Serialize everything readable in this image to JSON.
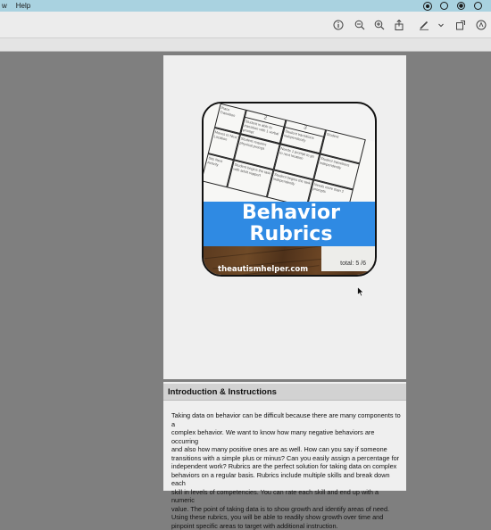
{
  "menubar": {
    "items": [
      "w",
      "Help"
    ],
    "tray_icons": [
      "record-icon",
      "chat-icon",
      "chrome-icon",
      "options-icon"
    ]
  },
  "toolbar": {
    "buttons": [
      "info-icon",
      "zoom-out-icon",
      "zoom-in-icon",
      "share-icon",
      "markup-pen-icon",
      "chevron-down-icon",
      "rotate-icon",
      "markup-circle-icon"
    ]
  },
  "document": {
    "cover": {
      "title_line1": "Behavior",
      "title_line2": "Rubrics",
      "website": "theautismhelper.com",
      "total_label": "total:",
      "total_value": "5 /6",
      "sheet_cells": [
        "Place Transition",
        "2",
        "Student is able to transition with 1 verbal prompt",
        "3",
        "Student transitions independently",
        "Moves to Next Location",
        "Student requires physical prompt",
        "Needs 1 prompt to go to next location",
        "Student transitions independently",
        "Sits Next Activity",
        "Student begins the task with adult support",
        "Student begins the task independently",
        "Needs more than 2 prompts",
        "Student"
      ]
    },
    "section": {
      "title": "Introduction & Instructions",
      "lines": [
        "Taking data on behavior can be difficult because there are many components to a",
        "complex behavior. We want to know how many negative behaviors are occurring",
        "and also how many positive ones are as well. How can you say if someone",
        "transitions with a simple plus or minus? Can you easily assign a percentage for",
        "independent work? Rubrics are the perfect solution for taking data on complex",
        "behaviors on a regular basis. Rubrics include multiple skills and break down each",
        "skill in levels of competencies. You can rate each skill and end up with a numeric",
        "value. The point of taking data is to show growth and identify areas of need.",
        "Using these rubrics, you will be able to readily show growth over time and",
        "pinpoint specific areas to target with additional instruction."
      ]
    }
  },
  "colors": {
    "menubar": "#a9d2e0",
    "banner": "#2f8ae3",
    "background": "#7f7f7f"
  }
}
